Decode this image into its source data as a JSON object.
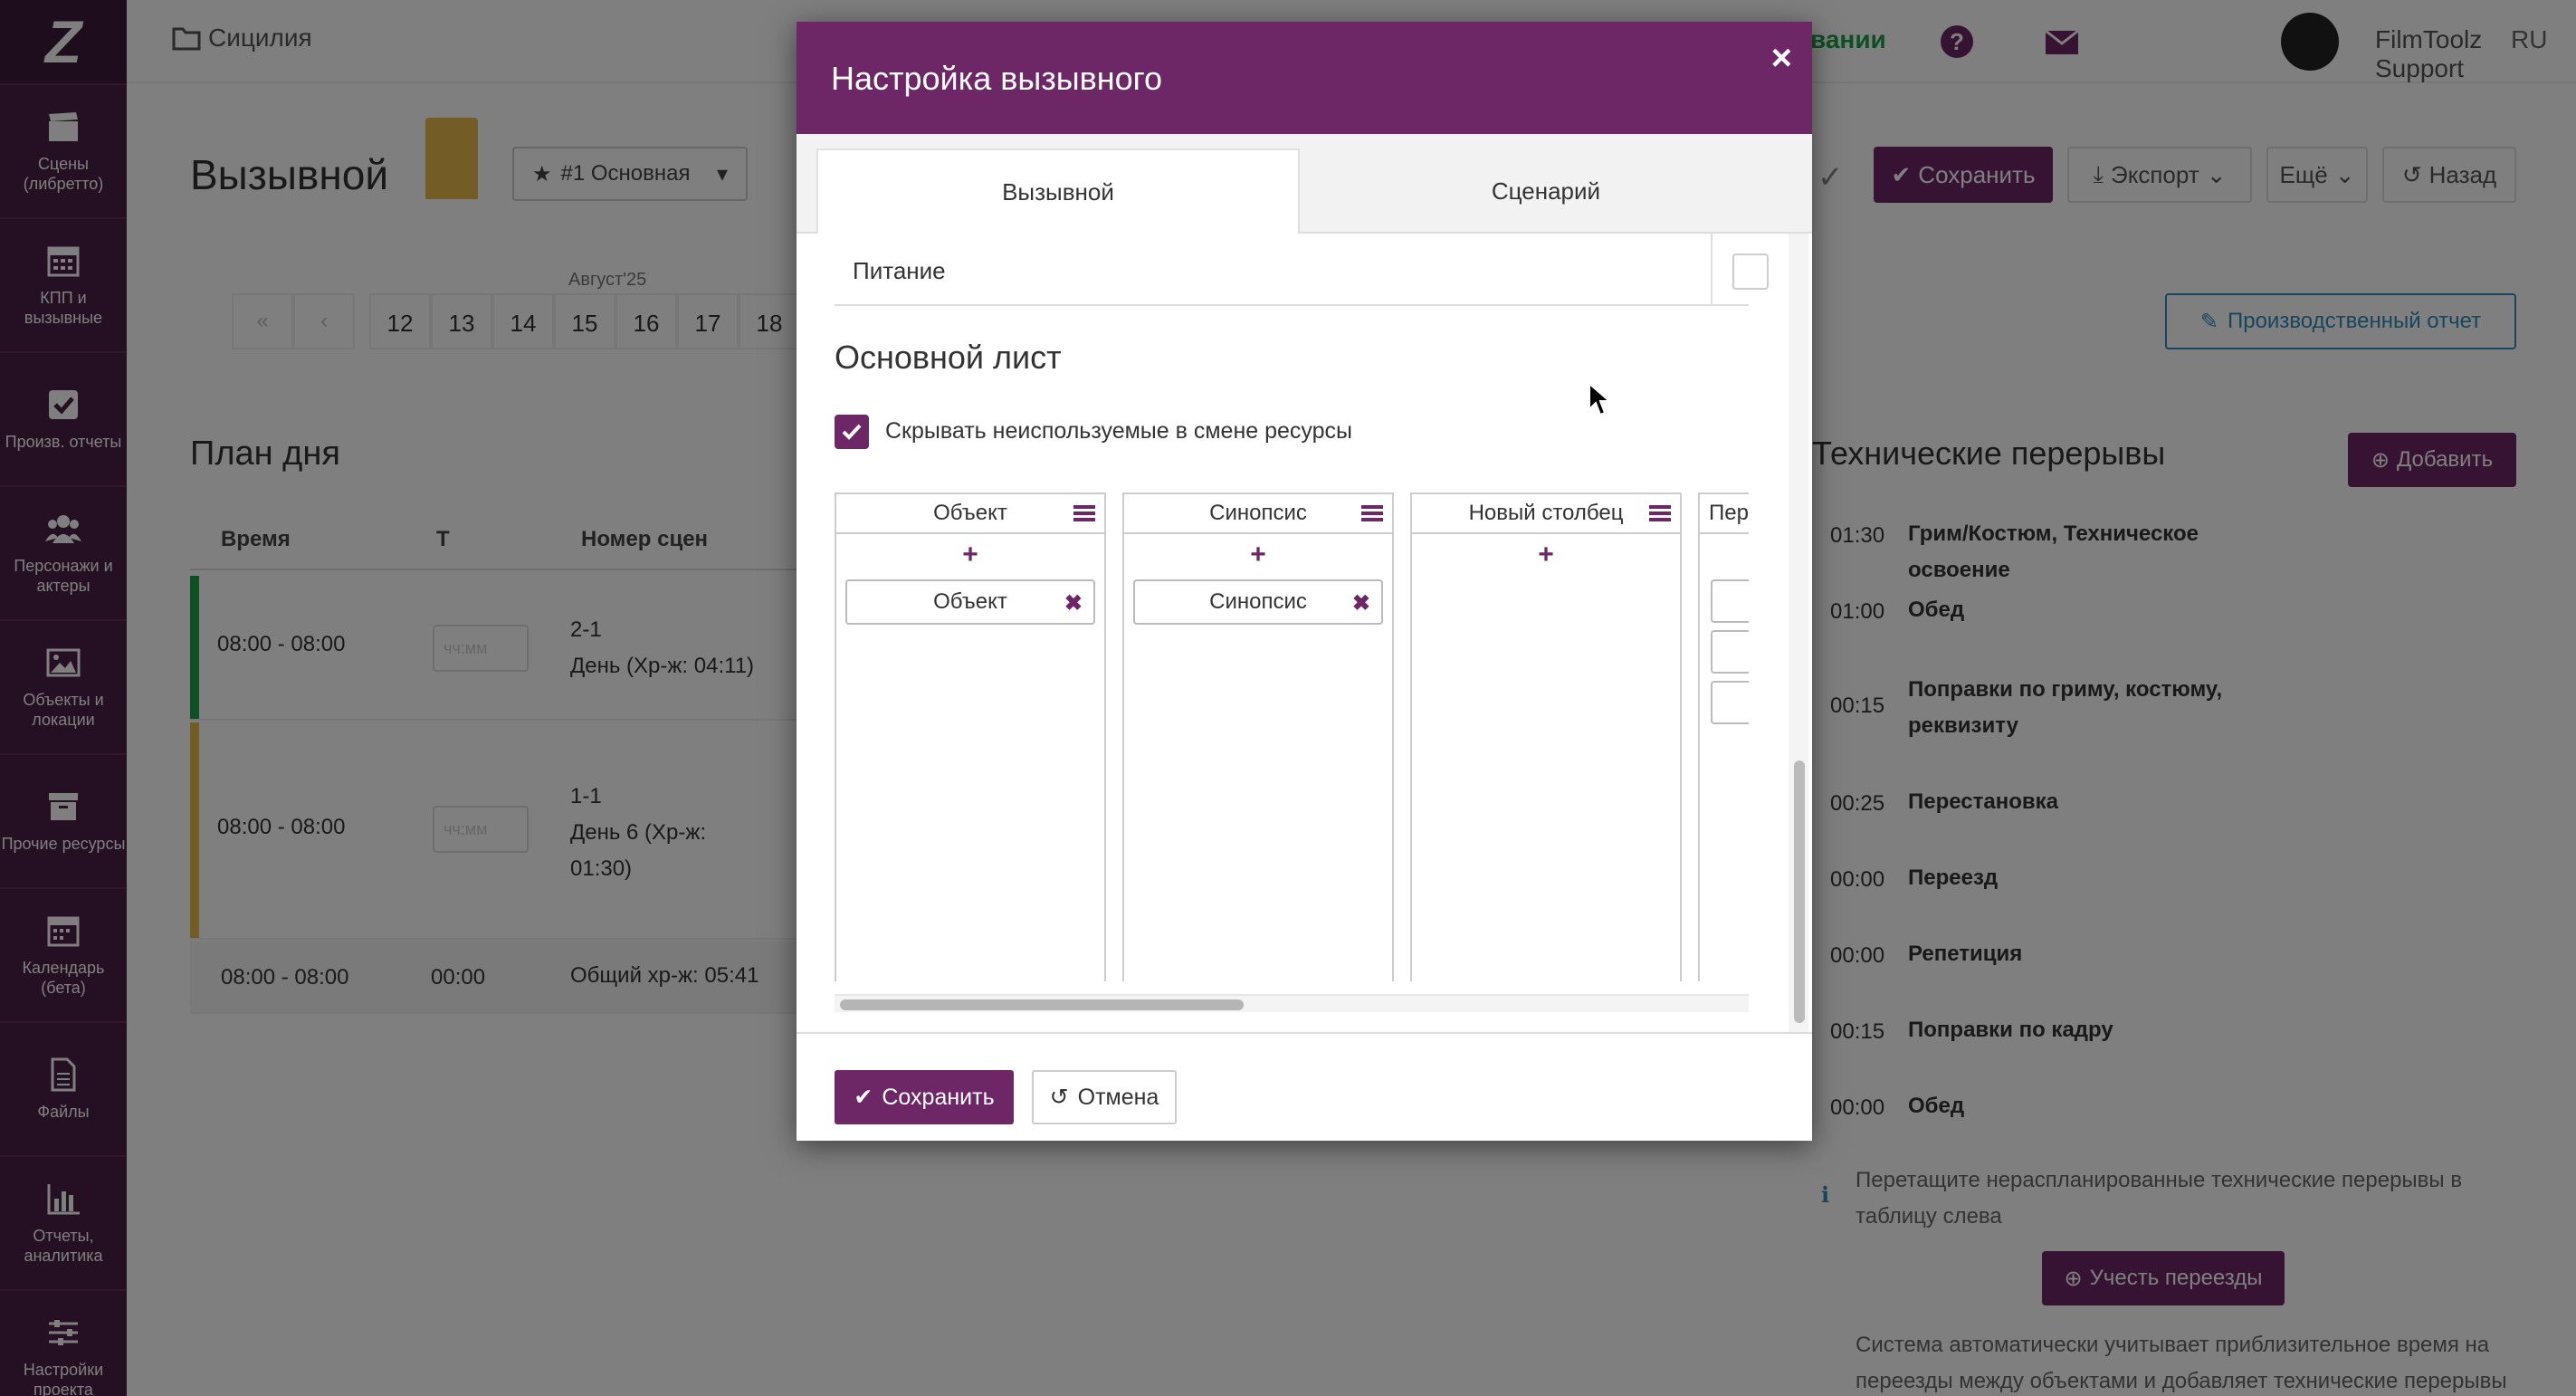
{
  "sidebar": {
    "logo": "Z",
    "items": [
      {
        "label": "Сцены (либретто)",
        "icon": "clapperboard-icon"
      },
      {
        "label": "КПП и вызывные",
        "icon": "calendar-grid-icon"
      },
      {
        "label": "Произв. отчеты",
        "icon": "checkbox-icon"
      },
      {
        "label": "Персонажи и актеры",
        "icon": "people-icon"
      },
      {
        "label": "Объекты и локации",
        "icon": "picture-icon"
      },
      {
        "label": "Прочие ресурсы",
        "icon": "archive-icon"
      },
      {
        "label": "Календарь (бета)",
        "icon": "calendar-icon"
      },
      {
        "label": "Файлы",
        "icon": "file-icon"
      },
      {
        "label": "Отчеты, аналитика",
        "icon": "bar-chart-icon"
      },
      {
        "label": "Настройки проекта",
        "icon": "sliders-icon"
      }
    ]
  },
  "topbar": {
    "breadcrumb": "Сицилия",
    "partial_link": "вании",
    "user_name": "FilmToolz Support",
    "lang": "RU"
  },
  "page": {
    "title": "Вызывной",
    "version_select": "#1 Основная",
    "month": "Август'25",
    "days": [
      "12",
      "13",
      "14",
      "15",
      "16",
      "17",
      "18"
    ],
    "buttons": {
      "save": "Сохранить",
      "export": "Экспорт",
      "more": "Ещё",
      "back": "Назад",
      "production_report": "Производственный отчет"
    }
  },
  "plan": {
    "title": "План дня",
    "columns": {
      "time": "Время",
      "t": "Т",
      "scene_no": "Номер сцен"
    },
    "rows": [
      {
        "time": "08:00 - 08:00",
        "placeholder": "чч:мм",
        "scene": "2-1",
        "detail": "День (Хр-ж: 04:11)",
        "color": "#1e9e4a"
      },
      {
        "time": "08:00 - 08:00",
        "placeholder": "чч:мм",
        "scene": "1-1",
        "detail": "День 6 (Хр-ж: 01:30)",
        "color": "#e8b84a"
      }
    ],
    "total": {
      "time": "08:00 - 08:00",
      "t": "00:00",
      "text": "Общий хр-ж: 05:41"
    }
  },
  "tech": {
    "title": "Технические перерывы",
    "add": "Добавить",
    "rows": [
      {
        "time": "01:30",
        "name": "Грим/Костюм, Техническое освоение"
      },
      {
        "time": "01:00",
        "name": "Обед"
      },
      {
        "time": "00:15",
        "name": "Поправки по гриму, костюму, реквизиту"
      },
      {
        "time": "00:25",
        "name": "Перестановка"
      },
      {
        "time": "00:00",
        "name": "Переезд"
      },
      {
        "time": "00:00",
        "name": "Репетиция"
      },
      {
        "time": "00:15",
        "name": "Поправки по кадру"
      },
      {
        "time": "00:00",
        "name": "Обед"
      }
    ],
    "hint": "Перетащите нераспланированные технические перерывы в таблицу слева",
    "moves_button": "Учесть переезды",
    "moves_note": "Система автоматически учитывает приблизительное время на переезды между объектами и добавляет технические перерывы"
  },
  "modal": {
    "title": "Настройка вызывного",
    "close": "×",
    "tabs": [
      "Вызывной",
      "Сценарий"
    ],
    "feed_row": "Питание",
    "section_title": "Основной лист",
    "hide_unused_label": "Скрывать неиспользуемые в смене ресурсы",
    "hide_unused_checked": true,
    "columns": [
      {
        "header": "Объект",
        "tag": "Объект"
      },
      {
        "header": "Синопсис",
        "tag": "Синопсис"
      },
      {
        "header": "Новый столбец",
        "tag": ""
      },
      {
        "header": "Пер",
        "tag": ""
      }
    ],
    "save": "Сохранить",
    "cancel": "Отмена"
  },
  "colors": {
    "brand": "#6d2766",
    "sidebar": "#4a1f45",
    "green": "#1e9e4a",
    "blue": "#2a8dbd"
  }
}
